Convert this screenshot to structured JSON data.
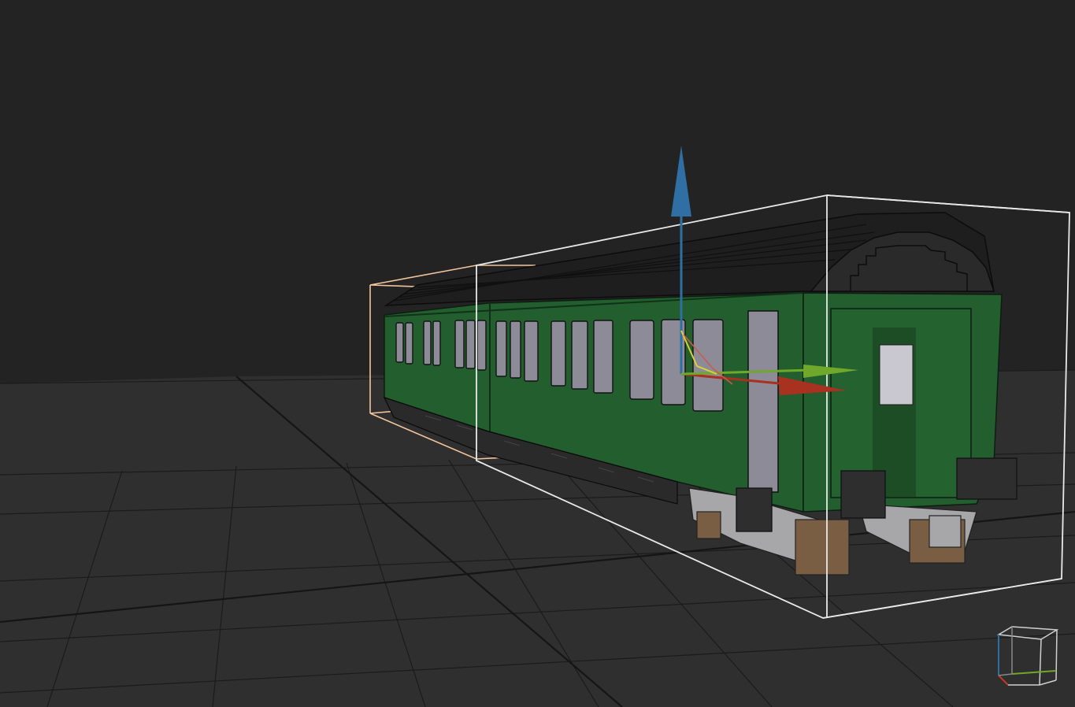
{
  "app": {
    "view": "3d-voxel-viewport",
    "selected_object": "passenger-coach-voxel-model"
  },
  "colors": {
    "background": "#232323",
    "floor": "#2f2f2f",
    "grid_line": "#1b1b1b",
    "grid_major": "#151515",
    "coach_body": "#235e2e",
    "coach_body_dark": "#1c4d25",
    "roof": "#1e1e1e",
    "window": "#8d8b98",
    "chassis": "#2a2a2a",
    "bogie": "#a7a7a9",
    "wood": "#7a5e44",
    "selection_box": "#e9e9e9",
    "secondary_box": "#f2c59c",
    "axis_x": "#a8311f",
    "axis_y": "#6fa82a",
    "axis_z": "#2f6fa3"
  },
  "gizmo": {
    "axes": [
      "x",
      "y",
      "z"
    ],
    "icon": "move-gizmo-icon"
  },
  "view_cube": {
    "icon": "view-cube-icon"
  }
}
